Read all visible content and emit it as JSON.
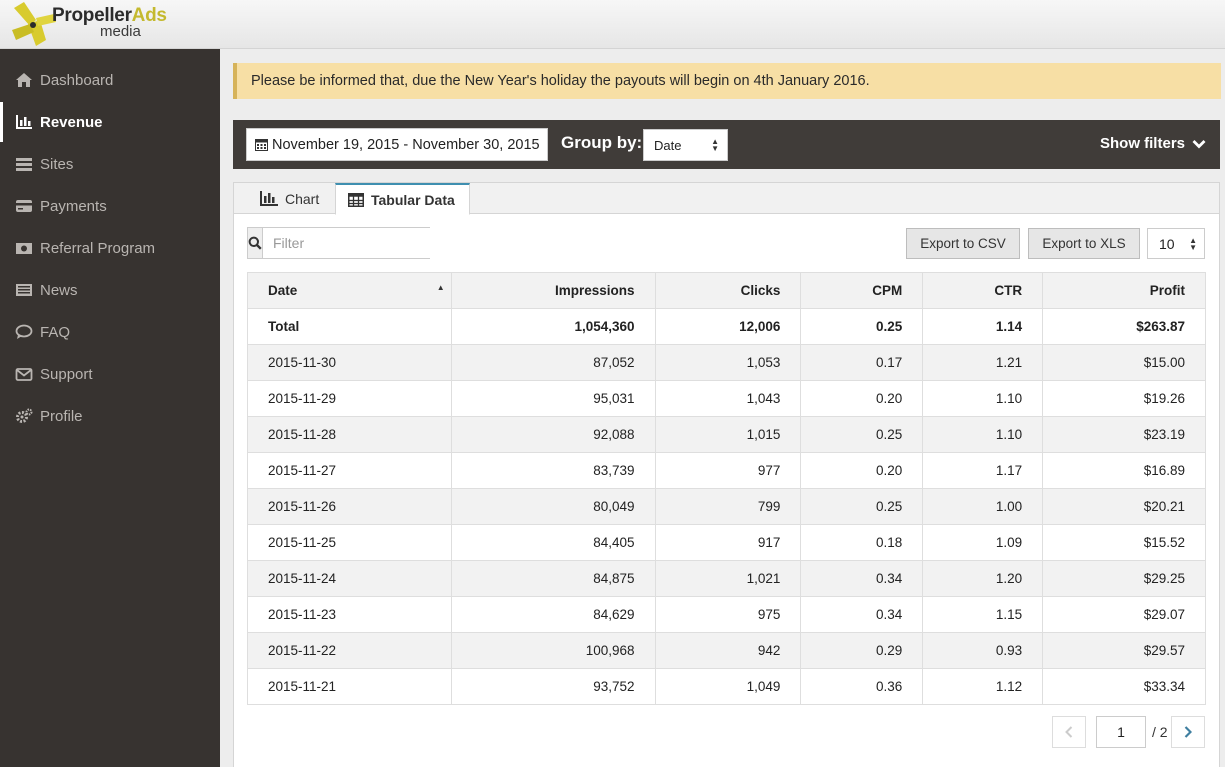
{
  "brand": {
    "name_part1": "Propeller",
    "name_part2": "Ads",
    "sub": "media"
  },
  "sidebar": {
    "items": [
      {
        "label": "Dashboard",
        "icon": "home-icon"
      },
      {
        "label": "Revenue",
        "icon": "bar-chart-icon",
        "active": true
      },
      {
        "label": "Sites",
        "icon": "list-icon"
      },
      {
        "label": "Payments",
        "icon": "credit-card-icon"
      },
      {
        "label": "Referral Program",
        "icon": "money-icon"
      },
      {
        "label": "News",
        "icon": "newspaper-icon"
      },
      {
        "label": "FAQ",
        "icon": "comment-icon"
      },
      {
        "label": "Support",
        "icon": "envelope-icon"
      },
      {
        "label": "Profile",
        "icon": "gears-icon"
      }
    ]
  },
  "notice": "Please be informed that, due the New Year's holiday the payouts will begin on 4th January 2016.",
  "toolbar": {
    "date_range": "November 19, 2015 - November 30, 2015",
    "group_by_label": "Group by:",
    "group_by_value": "Date",
    "show_filters": "Show filters"
  },
  "tabs": [
    {
      "label": "Chart"
    },
    {
      "label": "Tabular Data",
      "active": true
    }
  ],
  "controls": {
    "filter_placeholder": "Filter",
    "export_csv": "Export to CSV",
    "export_xls": "Export to XLS",
    "page_size": "10"
  },
  "table": {
    "headers": [
      "Date",
      "Impressions",
      "Clicks",
      "CPM",
      "CTR",
      "Profit"
    ],
    "total": [
      "Total",
      "1,054,360",
      "12,006",
      "0.25",
      "1.14",
      "$263.87"
    ],
    "rows": [
      [
        "2015-11-30",
        "87,052",
        "1,053",
        "0.17",
        "1.21",
        "$15.00"
      ],
      [
        "2015-11-29",
        "95,031",
        "1,043",
        "0.20",
        "1.10",
        "$19.26"
      ],
      [
        "2015-11-28",
        "92,088",
        "1,015",
        "0.25",
        "1.10",
        "$23.19"
      ],
      [
        "2015-11-27",
        "83,739",
        "977",
        "0.20",
        "1.17",
        "$16.89"
      ],
      [
        "2015-11-26",
        "80,049",
        "799",
        "0.25",
        "1.00",
        "$20.21"
      ],
      [
        "2015-11-25",
        "84,405",
        "917",
        "0.18",
        "1.09",
        "$15.52"
      ],
      [
        "2015-11-24",
        "84,875",
        "1,021",
        "0.34",
        "1.20",
        "$29.25"
      ],
      [
        "2015-11-23",
        "84,629",
        "975",
        "0.34",
        "1.15",
        "$29.07"
      ],
      [
        "2015-11-22",
        "100,968",
        "942",
        "0.29",
        "0.93",
        "$29.57"
      ],
      [
        "2015-11-21",
        "93,752",
        "1,049",
        "0.36",
        "1.12",
        "$33.34"
      ]
    ]
  },
  "pagination": {
    "current_page": "1",
    "total_label": "/ 2"
  },
  "colors": {
    "sidebar_bg": "#373330",
    "toolbar_bg": "#403c39",
    "notice_bg": "#f7dfa5",
    "brand_yellow": "#c4b92e",
    "tab_accent": "#3f8fb0"
  }
}
